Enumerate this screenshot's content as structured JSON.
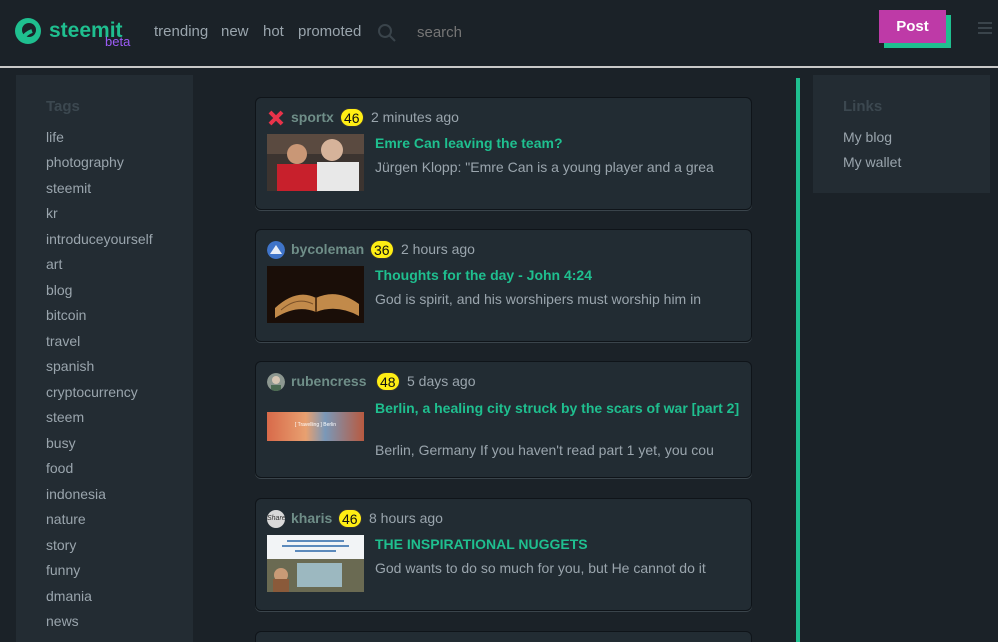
{
  "header": {
    "brand": "steemit",
    "beta": "beta",
    "nav": [
      "trending",
      "new",
      "hot",
      "promoted"
    ],
    "search_placeholder": "search",
    "post_label": "Post"
  },
  "sidebar": {
    "title": "Tags",
    "tags": [
      "life",
      "photography",
      "steemit",
      "kr",
      "introduceyourself",
      "art",
      "blog",
      "bitcoin",
      "travel",
      "spanish",
      "cryptocurrency",
      "steem",
      "busy",
      "food",
      "indonesia",
      "nature",
      "story",
      "funny",
      "dmania",
      "news"
    ]
  },
  "feed": [
    {
      "author": "sportx",
      "reputation": "46",
      "time": "2 minutes ago",
      "title": "Emre Can leaving the team?",
      "excerpt": "Jürgen Klopp: \"Emre Can is a young player and a grea"
    },
    {
      "author": "bycoleman",
      "reputation": "36",
      "time": "2 hours ago",
      "title": "Thoughts for the day - John 4:24",
      "excerpt": "God is spirit, and his worshipers must worship him in"
    },
    {
      "author": "rubencress",
      "reputation": "48",
      "time": "5 days ago",
      "title": "Berlin, a healing city struck by the scars of war [part 2]",
      "excerpt": "Berlin, Germany If you haven't read part 1 yet, you cou",
      "thumb_caption": "[ Travelling ] Berlin"
    },
    {
      "author": "kharis",
      "reputation": "46",
      "time": "8 hours ago",
      "title": "THE INSPIRATIONAL NUGGETS",
      "excerpt": "God wants to do so much for you, but He cannot do it",
      "avatar_label": "Share"
    }
  ],
  "links": {
    "title": "Links",
    "items": [
      "My blog",
      "My wallet"
    ]
  },
  "colors": {
    "accent": "#1fbf8f",
    "post": "#be3aa7",
    "background": "#1b2228",
    "panel": "#232c33",
    "reputation": "#ffee14"
  }
}
